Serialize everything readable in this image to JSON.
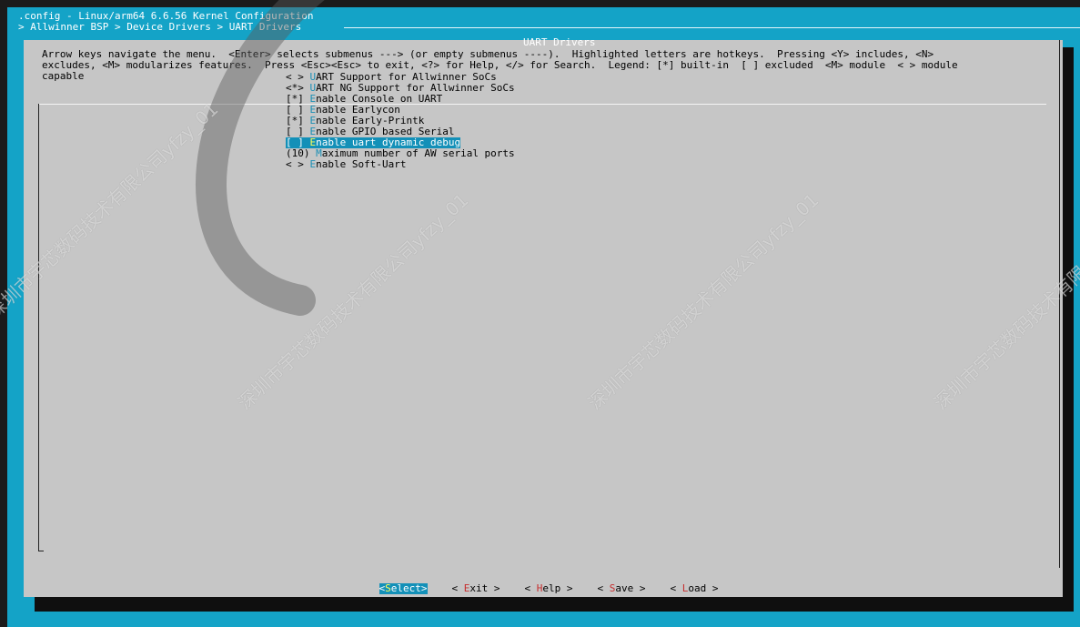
{
  "header": {
    "title": ".config - Linux/arm64 6.6.56 Kernel Configuration",
    "breadcrumb": "> Allwinner BSP > Device Drivers > UART Drivers"
  },
  "dialog": {
    "title": "UART Drivers",
    "help_text": "Arrow keys navigate the menu.  <Enter> selects submenus ---> (or empty submenus ----).  Highlighted letters are hotkeys.  Pressing <Y> includes, <N>\nexcludes, <M> modularizes features.  Press <Esc><Esc> to exit, <?> for Help, </> for Search.  Legend: [*] built-in  [ ] excluded  <M> module  < > module\ncapable"
  },
  "menu": {
    "items": [
      {
        "prefix": "< > ",
        "hotkey": "U",
        "rest": "ART Support for Allwinner SoCs"
      },
      {
        "prefix": "<*> ",
        "hotkey": "U",
        "rest": "ART NG Support for Allwinner SoCs"
      },
      {
        "prefix": "[*] ",
        "hotkey": "E",
        "rest": "nable Console on UART"
      },
      {
        "prefix": "[ ] ",
        "hotkey": "E",
        "rest": "nable Earlycon"
      },
      {
        "prefix": "[*] ",
        "hotkey": "E",
        "rest": "nable Early-Printk"
      },
      {
        "prefix": "[ ] ",
        "hotkey": "E",
        "rest": "nable GPIO based Serial"
      },
      {
        "prefix": "[ ] ",
        "hotkey": "E",
        "rest": "nable uart dynamic debug"
      },
      {
        "prefix": "(10) ",
        "hotkey": "M",
        "rest": "aximum number of AW serial ports"
      },
      {
        "prefix": "< > ",
        "hotkey": "E",
        "rest": "nable Soft-Uart"
      }
    ],
    "selected_index": 6
  },
  "buttons": {
    "select": {
      "open": "<",
      "hotkey": "S",
      "rest": "elect",
      "close": ">"
    },
    "exit": {
      "open": "< ",
      "hotkey": "E",
      "rest": "xit",
      "close": " >"
    },
    "help": {
      "open": "< ",
      "hotkey": "H",
      "rest": "elp",
      "close": " >"
    },
    "save": {
      "open": "< ",
      "hotkey": "S",
      "rest": "ave",
      "close": " >"
    },
    "load": {
      "open": "< ",
      "hotkey": "L",
      "rest": "oad",
      "close": " >"
    }
  },
  "watermark": {
    "text": "深圳市宇芯数码技术有限公司yfzy_01"
  }
}
